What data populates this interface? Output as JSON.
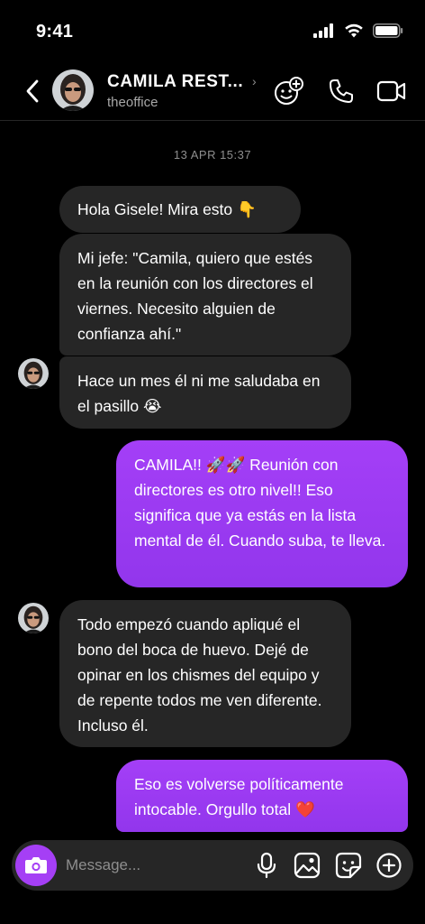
{
  "status_bar": {
    "time": "9:41"
  },
  "header": {
    "contact_name": "CAMILA REST...",
    "handle": "theoffice",
    "name_chevron": "›"
  },
  "chat": {
    "timestamp": "13 APR 15:37",
    "messages": [
      {
        "from": "them",
        "text": "Hola Gisele! Mira esto 👇"
      },
      {
        "from": "them",
        "text": "Mi jefe: \"Camila, quiero que estés en la reunión con los directores el viernes. Necesito alguien de confianza ahí.\""
      },
      {
        "from": "them",
        "text": "Hace un mes él ni me saludaba en el pasillo 😭"
      },
      {
        "from": "me",
        "text": "CAMILA!! 🚀🚀 Reunión con directores es otro nivel!! Eso significa que ya estás en la lista mental de él. Cuando suba, te lleva."
      },
      {
        "from": "them",
        "text": "Todo empezó cuando apliqué el bono del boca de huevo. Dejé de opinar en los chismes del equipo y de repente todos me ven diferente. Incluso él."
      },
      {
        "from": "me",
        "text": "Eso es volverse políticamente intocable. Orgullo total ❤️"
      }
    ]
  },
  "composer": {
    "placeholder": "Message..."
  },
  "colors": {
    "accent": "#a53ff5",
    "bubble_in": "#262626",
    "background": "#000000"
  },
  "icons": [
    "back-arrow-icon",
    "add-people-icon",
    "phone-icon",
    "video-camera-icon",
    "camera-icon",
    "microphone-icon",
    "image-icon",
    "sticker-icon",
    "plus-circle-icon"
  ]
}
